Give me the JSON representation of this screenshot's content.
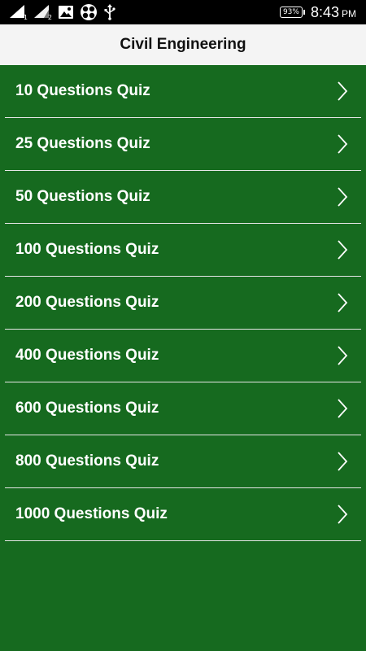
{
  "status_bar": {
    "sim1": "1",
    "sim2": "2",
    "battery": "93%",
    "time": "8:43",
    "ampm": "PM"
  },
  "app_bar": {
    "title": "Civil Engineering"
  },
  "quiz_list": [
    {
      "label": "10 Questions Quiz"
    },
    {
      "label": "25 Questions Quiz"
    },
    {
      "label": "50 Questions Quiz"
    },
    {
      "label": "100 Questions Quiz"
    },
    {
      "label": "200 Questions Quiz"
    },
    {
      "label": "400 Questions Quiz"
    },
    {
      "label": "600 Questions Quiz"
    },
    {
      "label": "800 Questions Quiz"
    },
    {
      "label": "1000 Questions Quiz"
    }
  ],
  "colors": {
    "background": "#166a1f",
    "app_bar": "#f4f4f4",
    "divider": "#e6e6e6"
  }
}
